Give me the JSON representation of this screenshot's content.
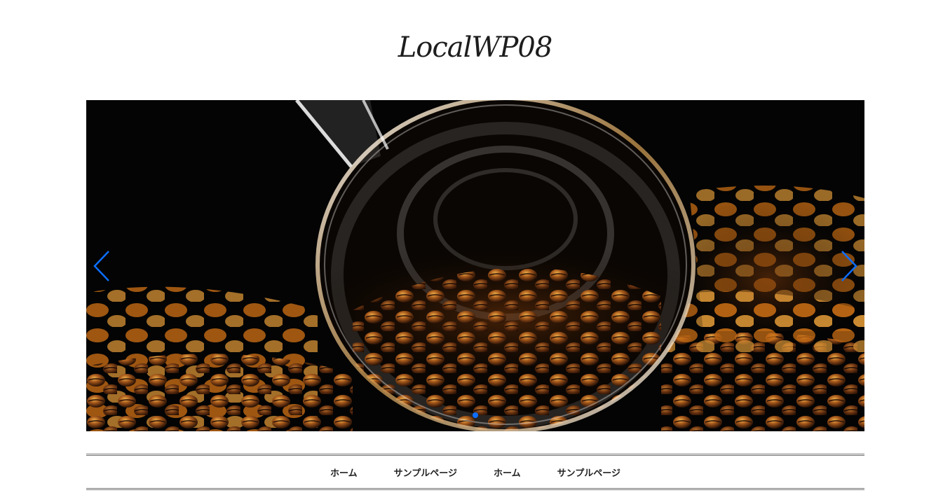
{
  "site": {
    "title": "LocalWP08"
  },
  "slider": {
    "image_alt": "Coffee beans spilling from a glass cup",
    "active_slide": 1,
    "slide_count": 1,
    "accent_color": "#0d6efd",
    "prev_icon": "chevron-left-icon",
    "next_icon": "chevron-right-icon"
  },
  "nav": {
    "items": [
      {
        "label": "ホーム"
      },
      {
        "label": "サンプルページ"
      },
      {
        "label": "ホーム"
      },
      {
        "label": "サンプルページ"
      }
    ]
  }
}
